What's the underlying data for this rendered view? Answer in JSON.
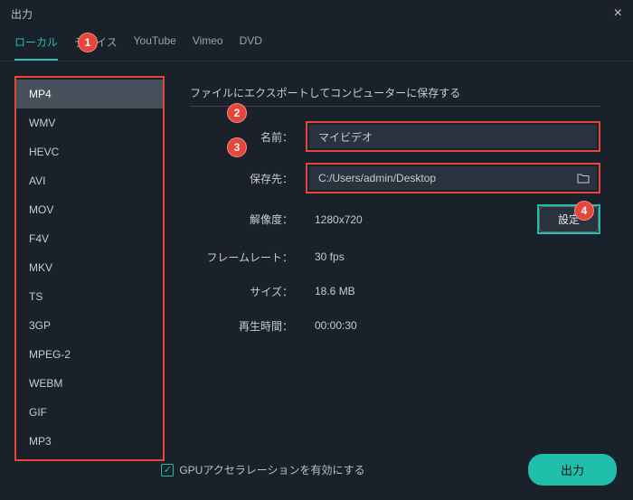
{
  "window": {
    "title": "出力"
  },
  "tabs": {
    "items": [
      {
        "label": "ローカル",
        "active": true
      },
      {
        "label": "デバイス"
      },
      {
        "label": "YouTube"
      },
      {
        "label": "Vimeo"
      },
      {
        "label": "DVD"
      }
    ]
  },
  "formats": {
    "items": [
      "MP4",
      "WMV",
      "HEVC",
      "AVI",
      "MOV",
      "F4V",
      "MKV",
      "TS",
      "3GP",
      "MPEG-2",
      "WEBM",
      "GIF",
      "MP3"
    ],
    "selected": "MP4"
  },
  "section": {
    "title": "ファイルにエクスポートしてコンピューターに保存する"
  },
  "fields": {
    "name_label": "名前：",
    "name_value": "マイビデオ",
    "dest_label": "保存先：",
    "dest_value": "C:/Users/admin/Desktop",
    "res_label": "解像度：",
    "res_value": "1280x720",
    "fps_label": "フレームレート：",
    "fps_value": "30 fps",
    "size_label": "サイズ：",
    "size_value": "18.6 MB",
    "dur_label": "再生時間：",
    "dur_value": "00:00:30",
    "settings_btn": "設定"
  },
  "footer": {
    "gpu_label": "GPUアクセラレーションを有効にする",
    "export_btn": "出力"
  },
  "callouts": {
    "c1": "1",
    "c2": "2",
    "c3": "3",
    "c4": "4"
  }
}
